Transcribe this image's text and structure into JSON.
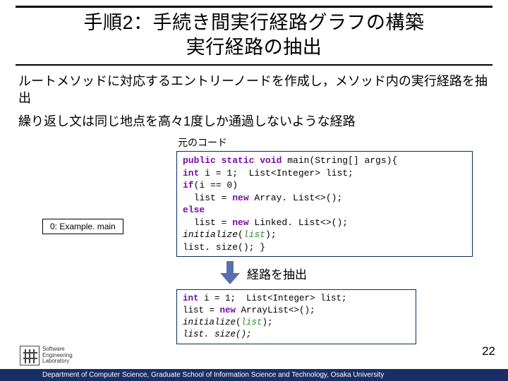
{
  "title": {
    "line1": "手順2：手続き間実行経路グラフの構築",
    "line2": "実行経路の抽出"
  },
  "body": {
    "p1": "ルートメソッドに対応するエントリーノードを作成し，メソッド内の実行経路を抽出",
    "p2": "繰り返し文は同じ地点を高々1度しか通過しないような経路"
  },
  "code_label": "元のコード",
  "code_top": {
    "l1a": "public static void",
    "l1b": " main(String[] args){",
    "l2a": "int",
    "l2b": " i = 1;  List<Integer> list;",
    "l3a": "if",
    "l3b": "(i == 0)",
    "l4a": "  list = ",
    "l4b": "new",
    "l4c": " Array. List<>();",
    "l5a": "else",
    "l6a": "  list = ",
    "l6b": "new",
    "l6c": " Linked. List<>();",
    "l7a": "initialize",
    "l7b": "(",
    "l7c": "list",
    "l7d": ");",
    "l8": "list. size(); }"
  },
  "node_label": "0: Example. main",
  "arrow_label": "経路を抽出",
  "code_bottom": {
    "l1a": "int",
    "l1b": " i = 1;  List<Integer> list;",
    "l2a": "list = ",
    "l2b": "new",
    "l2c": " ArrayList<>();",
    "l3a": "initialize",
    "l3b": "(",
    "l3c": "list",
    "l3d": ");",
    "l4": "list. size();"
  },
  "page_number": "22",
  "footer": "Department of Computer Science, Graduate School of Information Science and Technology, Osaka University",
  "logo": {
    "l1": "Software",
    "l2": "Engineering",
    "l3": "Laboratory"
  }
}
